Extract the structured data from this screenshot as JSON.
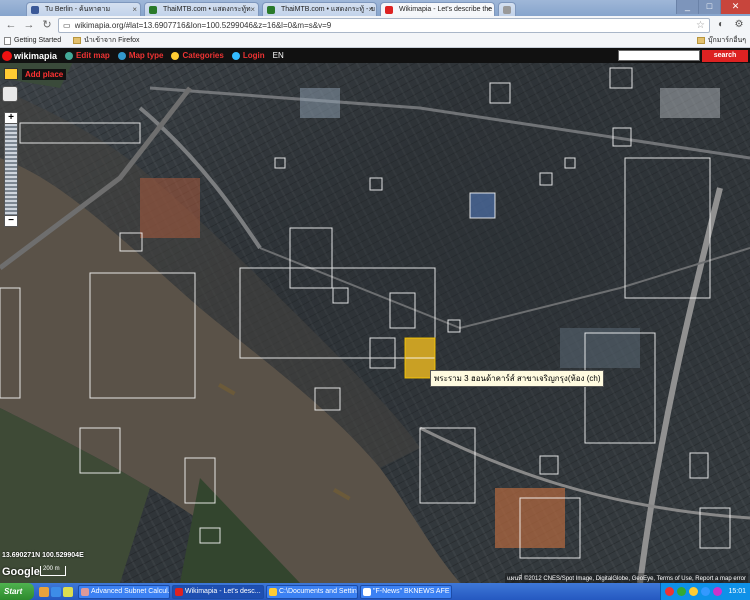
{
  "browser": {
    "tabs": [
      {
        "label": "Tu Berlin - ค้นหาตาม",
        "color": "#3b5998",
        "active": false
      },
      {
        "label": "ThaiMTB.com • แสดงกระทู้ท",
        "color": "#2a7a2a",
        "active": false
      },
      {
        "label": "ThaiMTB.com • แสดงกระทู้ - ข",
        "color": "#2a7a2a",
        "active": false
      },
      {
        "label": "Wikimapia - Let's describe the",
        "color": "#d22",
        "active": true
      },
      {
        "label": "",
        "color": "#999",
        "active": false
      }
    ],
    "url": "wikimapia.org/#lat=13.6907716&lon=100.5299046&z=16&l=0&m=s&v=9",
    "bookmarks": [
      {
        "label": "Getting Started",
        "kind": "page"
      },
      {
        "label": "นำเข้าจาก Firefox",
        "kind": "folder"
      }
    ],
    "bookmarks_right": "บุ๊กมาร์กอื่นๆ",
    "back_icon": "arrow-left-icon",
    "forward_icon": "arrow-right-icon",
    "reload_icon": "reload-icon"
  },
  "wikimapia": {
    "logo": "wikimapia",
    "menu": [
      {
        "label": "Edit map",
        "icon_color": "#4a9"
      },
      {
        "label": "Map type",
        "icon_color": "#39c"
      },
      {
        "label": "Categories",
        "icon_color": "#fc3"
      },
      {
        "label": "Login",
        "icon_color": "#3bf"
      }
    ],
    "language": "EN",
    "search_button": "search",
    "add_place": "Add place",
    "zoom_in": "+",
    "zoom_out": "−"
  },
  "map": {
    "tooltip": "พระราม 3 ฮอนด้าคาร์ส์ สาขาเจริญกรุง(ห้อง (ch)",
    "coordinates": "13.690271N 100.529904E",
    "google": "Google",
    "scale": "200 m",
    "copyright": "แผนที่ ©2012 CNES/Spot Image, DigitalGlobe, GeoEye, Terms of Use, Report a map error"
  },
  "taskbar": {
    "start": "Start",
    "tasks": [
      {
        "label": "Advanced Subnet Calcul...",
        "color": "#d99",
        "active": false
      },
      {
        "label": "Wikimapia - Let's desc...",
        "color": "#d22",
        "active": true
      },
      {
        "label": "C:\\Documents and Settin...",
        "color": "#fc3",
        "active": false
      },
      {
        "label": "\"F-News\" BKNEWS AFE #1",
        "color": "#fff",
        "active": false
      }
    ],
    "clock": "15:01"
  }
}
